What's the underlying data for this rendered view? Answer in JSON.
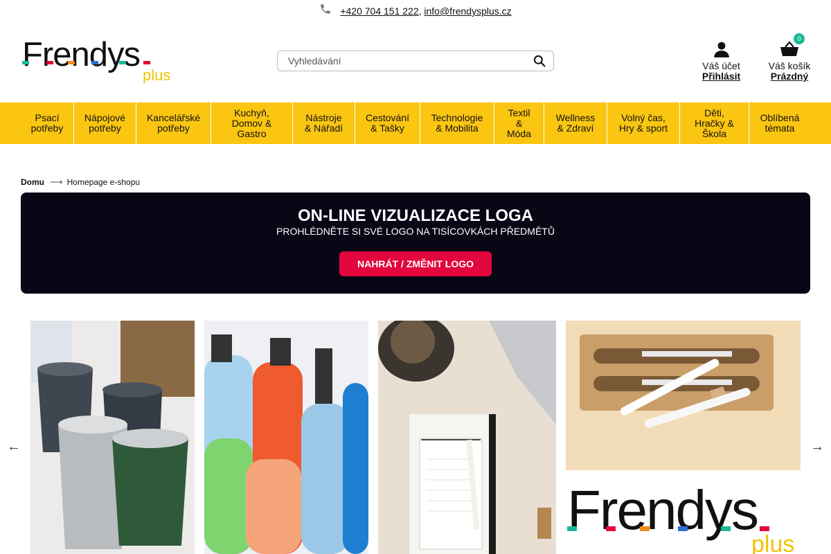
{
  "topbar": {
    "phone": "+420 704 151 222",
    "separator": ",",
    "email": "info@frendysplus.cz",
    "icon": "phone-icon"
  },
  "header": {
    "logo_word": "Frendys",
    "logo_plus": "plus",
    "search_placeholder": "Vyhledávání",
    "account_label": "Váš účet",
    "account_link": "Přihlásit",
    "cart_label": "Váš košík",
    "cart_link": "Prázdný",
    "cart_count": "0"
  },
  "nav": {
    "items": [
      "Psací\npotřeby",
      "Nápojové\npotřeby",
      "Kancelářské\npotřeby",
      "Kuchyň,\nDomov &\nGastro",
      "Nástroje\n& Nářadí",
      "Cestování\n& Tašky",
      "Technologie\n& Mobilita",
      "Textil\n&\nMóda",
      "Wellness\n& Zdraví",
      "Volný čas,\nHry & sport",
      "Děti,\nHračky &\nŠkola",
      "Oblíbená\ntémata"
    ]
  },
  "breadcrumb": {
    "home": "Domu",
    "current": "Homepage e-shopu"
  },
  "banner": {
    "title": "ON-LINE VIZUALIZACE LOGA",
    "subtitle": "PROHLÉDNĚTE SI SVÉ LOGO NA TISÍCOVKÁCH PŘEDMĚTŮ",
    "cta": "NAHRÁT / ZMĚNIT LOGO"
  },
  "carousel": {
    "prev": "←",
    "next": "→",
    "tile5_brand": "Frendys",
    "tile5_plus": "plus"
  },
  "colors": {
    "nav_bg": "#fbc612",
    "banner_bg": "#070716",
    "cta": "#e3053e",
    "badge": "#1bb896",
    "plus": "#f2c400"
  }
}
